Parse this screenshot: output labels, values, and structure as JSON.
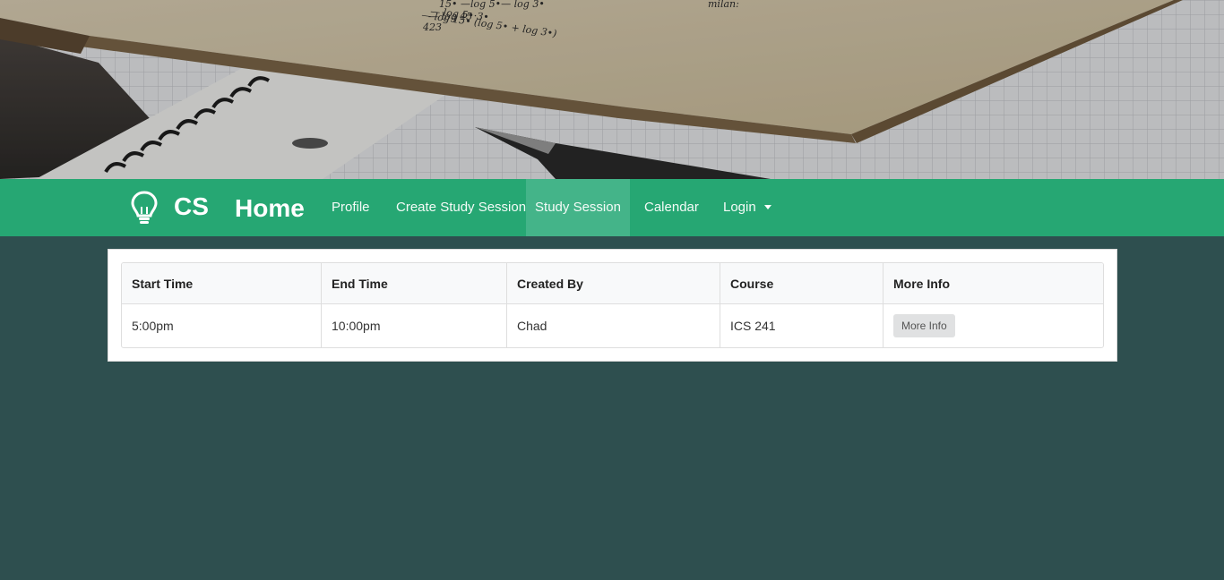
{
  "hero": {
    "image": "study-desk-photo",
    "caption_text": {
      "line1": "15• —log 5•— log 3•",
      "line2": "— log 15•  (log 5• + log 3•)",
      "line3": "— log 5•·3•",
      "line4": "— log 45",
      "line5": "423",
      "corner": "milan:"
    }
  },
  "navbar": {
    "brand_icon": "lightbulb-icon",
    "brand": "CS",
    "home": "Home",
    "items": [
      {
        "label": "Profile"
      },
      {
        "label": "Create Study Session"
      },
      {
        "label": "Study Session"
      },
      {
        "label": "Calendar"
      },
      {
        "label": "Login"
      }
    ],
    "login_caret_icon": "caret-down-icon",
    "active_item": "Study Session"
  },
  "table": {
    "headers": [
      "Start Time",
      "End Time",
      "Created By",
      "Course",
      "More Info"
    ],
    "rows": [
      {
        "start_time": "5:00pm",
        "end_time": "10:00pm",
        "created_by": "Chad",
        "course": "ICS 241",
        "more_info_label": "More Info"
      }
    ]
  },
  "colors": {
    "navbar": "#26a773",
    "navbar_active": "#44b489",
    "page_background": "#2e4f4f",
    "button": "#e0e1e2"
  }
}
